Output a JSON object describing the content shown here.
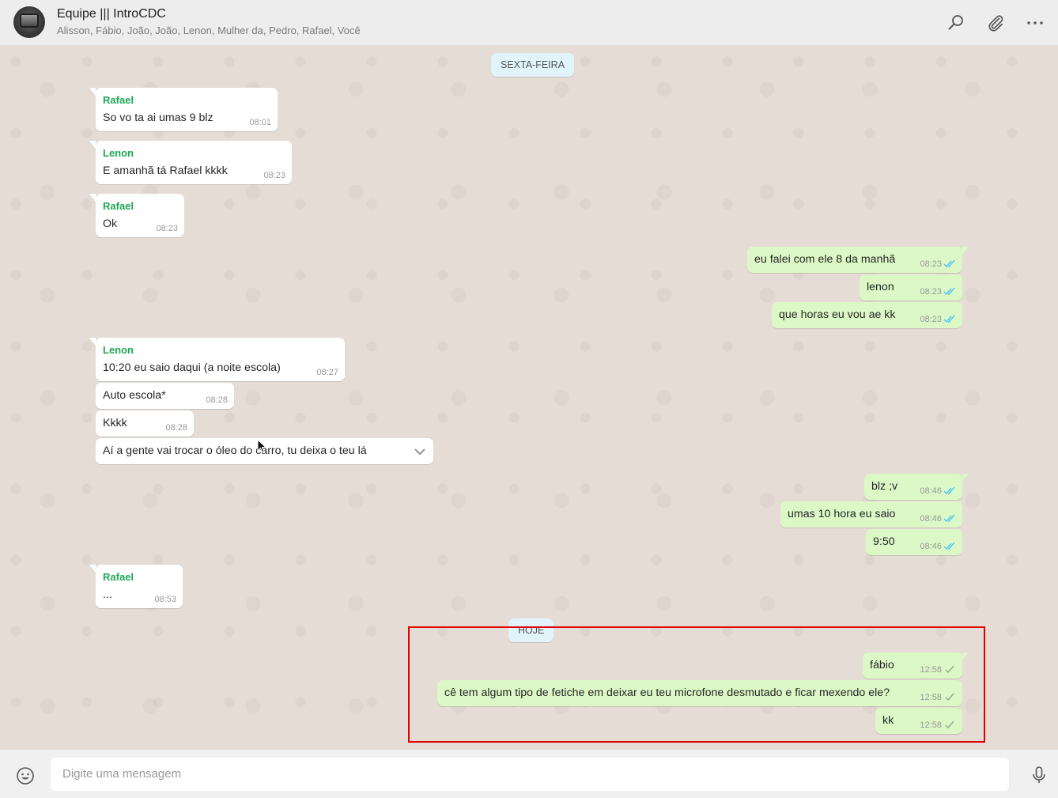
{
  "header": {
    "title": "Equipe ||| IntroCDC",
    "participants": "Alisson, Fábio, João, João, Lenon, Mulher da, Pedro, Rafael, Você",
    "icons": [
      "search-icon",
      "attach-icon",
      "menu-icon"
    ]
  },
  "day_labels": {
    "friday": "SEXTA-FEIRA",
    "today": "HOJE"
  },
  "messages": [
    {
      "sender": "Rafael",
      "text": "So vo ta ai umas 9 blz",
      "time": "08:01"
    },
    {
      "sender": "Lenon",
      "text": "E amanhã tá Rafael kkkk",
      "time": "08:23"
    },
    {
      "sender": "Rafael",
      "text": "Ok",
      "time": "08:23"
    },
    {
      "text": "eu falei com ele 8 da manhã",
      "time": "08:23",
      "status": "read"
    },
    {
      "text": "lenon",
      "time": "08:23",
      "status": "read"
    },
    {
      "text": "que horas eu vou ae kk",
      "time": "08:23",
      "status": "read"
    },
    {
      "sender": "Lenon",
      "text": "10:20 eu saio daqui (a noite escola)",
      "time": "08:27"
    },
    {
      "text": "Auto escola*",
      "time": "08:28"
    },
    {
      "text": "Kkkk",
      "time": "08:28"
    },
    {
      "text": "Aí a gente vai trocar o óleo do carro, tu deixa o teu lá"
    },
    {
      "text": "blz ;v",
      "time": "08:46",
      "status": "read"
    },
    {
      "text": "umas 10 hora eu saio",
      "time": "08:46",
      "status": "read"
    },
    {
      "text": "9:50",
      "time": "08:46",
      "status": "read"
    },
    {
      "sender": "Rafael",
      "text": "...",
      "time": "08:53"
    },
    {
      "text": "fábio",
      "time": "12:58",
      "status": "sent"
    },
    {
      "text": "cê tem algum tipo de fetiche em deixar eu teu microfone desmutado e ficar mexendo ele?",
      "time": "12:58",
      "status": "sent"
    },
    {
      "text": "kk",
      "time": "12:58",
      "status": "sent"
    }
  ],
  "composer": {
    "placeholder": "Digite uma mensagem"
  },
  "colors": {
    "incoming": "#ffffff",
    "outgoing": "#dcf8c6",
    "sender_name": "#1fa855",
    "read_tick": "#4fc3f7",
    "sent_tick": "#92a58c",
    "highlight": "#e00000"
  }
}
